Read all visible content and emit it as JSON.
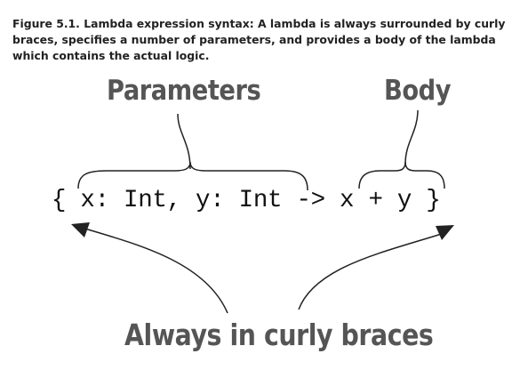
{
  "figure": {
    "caption": "Figure 5.1. Lambda expression syntax: A lambda is always surrounded by curly braces, specifies a number of parameters, and provides a body of the lambda which contains the actual logic."
  },
  "diagram": {
    "parameters_label": "Parameters",
    "body_label": "Body",
    "braces_label": "Always in curly braces",
    "code_line": "{ x: Int, y: Int -> x + y }"
  }
}
